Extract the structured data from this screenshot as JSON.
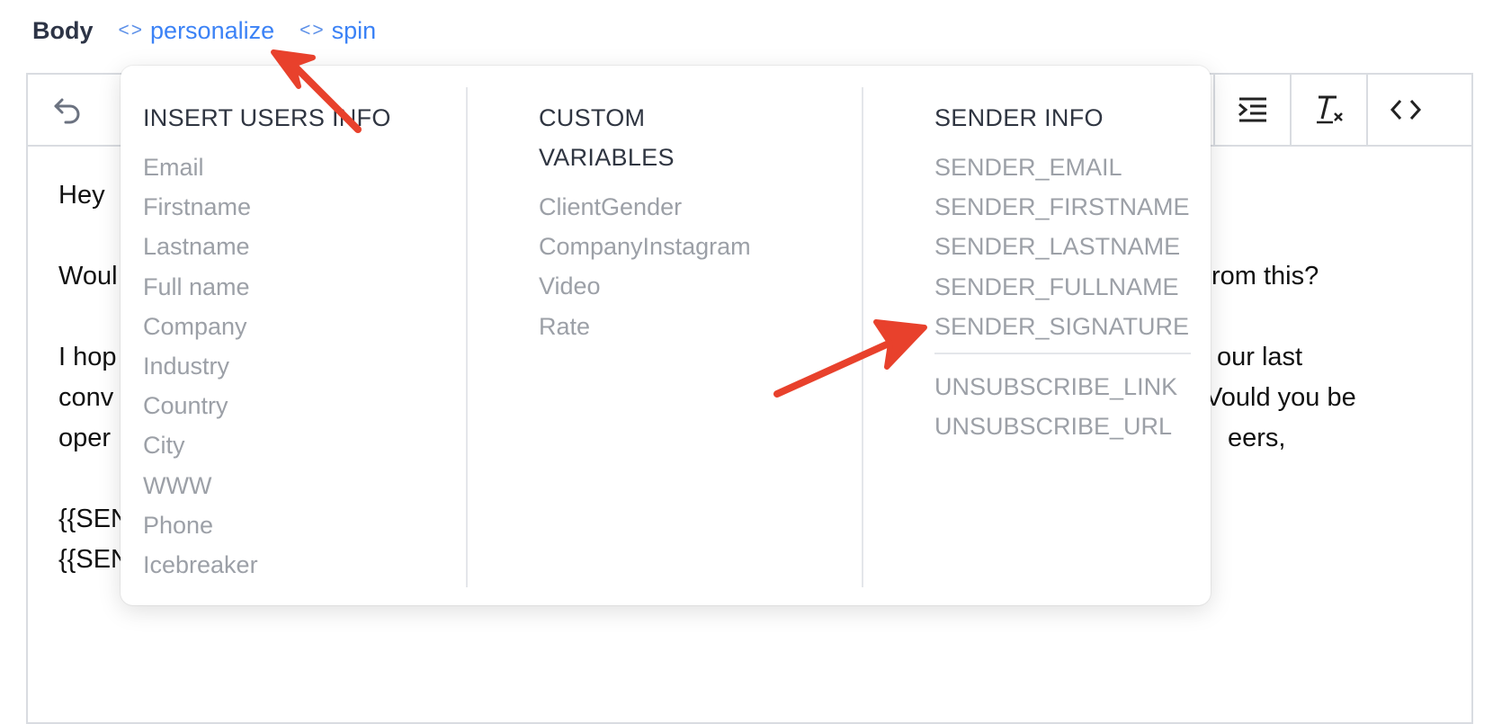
{
  "header": {
    "label": "Body",
    "personalize_link": "personalize",
    "spin_link": "spin",
    "code_glyph": "<>"
  },
  "toolbar": {
    "icons": [
      "undo-icon",
      "indent-icon",
      "clear-format-icon",
      "code-view-icon"
    ],
    "undo_glyph": "↶",
    "indent_glyph": "⇥",
    "clear_glyph": "T̲ₓ",
    "code_glyph": "<>"
  },
  "editor_content": {
    "line1": "Hey ",
    "line2_left": "Woul",
    "line2_right": "rom this?",
    "line3_left": "I hop",
    "line3_right": "our last",
    "line4_left": "conv",
    "line4_right": "Vould you be",
    "line5_left": "oper",
    "line5_right": "eers,",
    "line6": "{{SEN",
    "line7": "{{SEN"
  },
  "dropdown": {
    "users_info": {
      "heading": "INSERT USERS INFO",
      "items": [
        "Email",
        "Firstname",
        "Lastname",
        "Full name",
        "Company",
        "Industry",
        "Country",
        "City",
        "WWW",
        "Phone",
        "Icebreaker"
      ]
    },
    "custom_variables": {
      "heading_line1": "CUSTOM",
      "heading_line2": "VARIABLES",
      "items": [
        "ClientGender",
        "CompanyInstagram",
        "Video",
        "Rate"
      ]
    },
    "sender_info": {
      "heading": "SENDER INFO",
      "items": [
        "SENDER_EMAIL",
        "SENDER_FIRSTNAME",
        "SENDER_LASTNAME",
        "SENDER_FULLNAME",
        "SENDER_SIGNATURE"
      ],
      "unsubscribe_items": [
        "UNSUBSCRIBE_LINK",
        "UNSUBSCRIBE_URL"
      ]
    }
  },
  "colors": {
    "link": "#3b82f6",
    "annotation_arrow": "#e8412c",
    "muted_item": "#9ca0a7"
  }
}
